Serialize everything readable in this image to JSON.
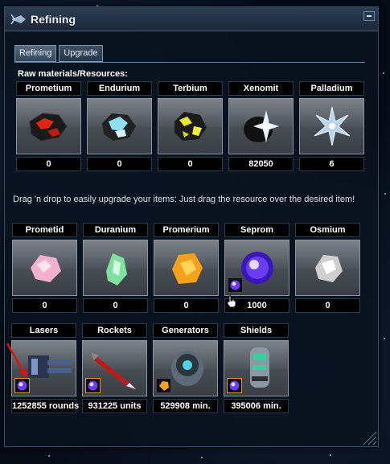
{
  "window": {
    "title": "Refining"
  },
  "tabs": [
    {
      "label": "Refining",
      "active": true
    },
    {
      "label": "Upgrade",
      "active": false
    }
  ],
  "raw_label": "Raw materials/Resources:",
  "raw": [
    {
      "name": "Prometium",
      "count": "0",
      "icon": "prometium-ore",
      "color": "#d22a1a"
    },
    {
      "name": "Endurium",
      "count": "0",
      "icon": "endurium-ore",
      "color": "#8fe0f2"
    },
    {
      "name": "Terbium",
      "count": "0",
      "icon": "terbium-ore",
      "color": "#e8e81e"
    },
    {
      "name": "Xenomit",
      "count": "82050",
      "icon": "xenomit-ore",
      "color": "#cfe6ff"
    },
    {
      "name": "Palladium",
      "count": "6",
      "icon": "palladium-crystal",
      "color": "#b9d4ea"
    }
  ],
  "info_text": "Drag 'n drop to easily upgrade your items: Just drag the resource over the desired item!",
  "refined": [
    {
      "name": "Prometid",
      "count": "0",
      "icon": "prometid-crystal",
      "color": "#f4b0cf"
    },
    {
      "name": "Duranium",
      "count": "0",
      "icon": "duranium-crystal",
      "color": "#7fe0a0"
    },
    {
      "name": "Promerium",
      "count": "0",
      "icon": "promerium-crystal",
      "color": "#f6a11d"
    },
    {
      "name": "Seprom",
      "count": "1000",
      "icon": "seprom-orb",
      "color": "#6b3df0"
    },
    {
      "name": "Osmium",
      "count": "0",
      "icon": "osmium-crystal",
      "color": "#e7e7e7"
    }
  ],
  "upgrades": [
    {
      "name": "Lasers",
      "count": "1252855 rounds",
      "icon": "laser-cannon-icon",
      "slot": "seprom"
    },
    {
      "name": "Rockets",
      "count": "931225 units",
      "icon": "rocket-icon",
      "slot": "seprom"
    },
    {
      "name": "Generators",
      "count": "529908 min.",
      "icon": "generator-icon",
      "slot": "promerium"
    },
    {
      "name": "Shields",
      "count": "395006 min.",
      "icon": "shield-generator-icon",
      "slot": "seprom"
    }
  ],
  "colors": {
    "accent": "#c7a23a",
    "window_border": "#3c4f66",
    "arrow": "#e01010"
  }
}
